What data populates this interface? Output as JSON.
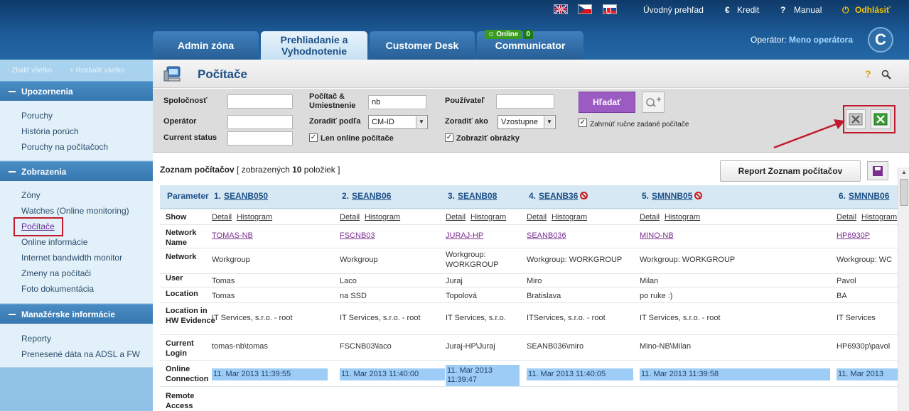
{
  "header": {
    "nav_links": [
      "Úvodný prehľad",
      "Kredit",
      "Manual",
      "Odhlásiť"
    ],
    "tabs": [
      "Admin zóna",
      "Prehliadanie a Vyhodnotenie",
      "Customer Desk",
      "Communicator"
    ],
    "online_label": "Online",
    "online_count": "0",
    "operator_label": "Operátor:",
    "operator_name": "Meno operátora",
    "logo_letter": "C"
  },
  "sidebar": {
    "collapse_all": "- Zbaliť všetko",
    "expand_all": "+ Rozbaliť všetko",
    "sections": [
      {
        "title": "Upozornenia",
        "items": [
          "Poruchy",
          "História porúch",
          "Poruchy na počítačoch"
        ]
      },
      {
        "title": "Zobrazenia",
        "items": [
          "Zóny",
          "Watches (Online monitoring)",
          "Počítače",
          "Online informácie",
          "Internet bandwidth monitor",
          "Zmeny na počítači",
          "Foto dokumentácia"
        ]
      },
      {
        "title": "Manažérske informácie",
        "items": [
          "Reporty",
          "Prenesené dáta na ADSL a FW"
        ]
      }
    ]
  },
  "page": {
    "title": "Počítače"
  },
  "filter": {
    "company_label": "Spoločnosť",
    "operator_label": "Operátor",
    "status_label": "Current status",
    "pc_label": "Počítač & Umiestnenie",
    "pc_value": "nb",
    "sort_by_label": "Zoradiť podľa",
    "sort_by_value": "CM-ID",
    "online_only_label": "Len online počítače",
    "user_label": "Používateľ",
    "sort_as_label": "Zoradiť ako",
    "sort_as_value": "Vzostupne",
    "show_images_label": "Zobraziť obrázky",
    "search_button": "Hľadať",
    "manual_pcs_label": "Zahrnúť ručne zadané počítače"
  },
  "list": {
    "title": "Zoznam počítačov",
    "count_prefix": "[ zobrazených ",
    "count": "10",
    "count_suffix": " položiek ]",
    "report_button": "Report Zoznam počítačov"
  },
  "table": {
    "param_header": "Parameter",
    "row_labels": [
      "Show",
      "Network Name",
      "Network",
      "User",
      "Location",
      "Location in HW Evidence",
      "Current Login",
      "Online Connection",
      "Remote Access"
    ],
    "detail_label": "Detail",
    "histogram_label": "Histogram",
    "columns": [
      {
        "num": "1.",
        "id": "SEANB050",
        "blocked": false,
        "network_name": "TOMAS-NB",
        "network": "Workgroup",
        "user": "Tomas",
        "location": "Tomas",
        "hw_location": "IT Services, s.r.o. - root",
        "login": "tomas-nb\\tomas",
        "online": "11. Mar 2013 11:39:55"
      },
      {
        "num": "2.",
        "id": "SEANB06",
        "blocked": false,
        "network_name": "FSCNB03",
        "network": "Workgroup",
        "user": "Laco",
        "location": "na SSD",
        "hw_location": "IT Services, s.r.o. - root",
        "login": "FSCNB03\\laco",
        "online": "11. Mar 2013 11:40:00"
      },
      {
        "num": "3.",
        "id": "SEANB08",
        "blocked": false,
        "network_name": "JURAJ-HP",
        "network": "Workgroup: WORKGROUP",
        "user": "Juraj",
        "location": "Topolová",
        "hw_location": "IT Services, s.r.o.",
        "login": "Juraj-HP\\Juraj",
        "online": "11. Mar 2013 11:39:47"
      },
      {
        "num": "4.",
        "id": "SEANB36",
        "blocked": true,
        "network_name": "SEANB036",
        "network": "Workgroup: WORKGROUP",
        "user": "Miro",
        "location": "Bratislava",
        "hw_location": "ITServices, s.r.o. - root",
        "login": "SEANB036\\miro",
        "online": "11. Mar 2013 11:40:05"
      },
      {
        "num": "5.",
        "id": "SMNNB05",
        "blocked": true,
        "network_name": "MINO-NB",
        "network": "Workgroup: WORKGROUP",
        "user": "Milan",
        "location": "po ruke :)",
        "hw_location": "IT Services, s.r.o. - root",
        "login": "Mino-NB\\Milan",
        "online": "11. Mar 2013 11:39:58"
      },
      {
        "num": "6.",
        "id": "SMNNB06",
        "blocked": false,
        "network_name": "HP6930P",
        "network": "Workgroup: WC",
        "user": "Pavol",
        "location": "BA",
        "hw_location": "IT Services",
        "login": "HP6930p\\pavol",
        "online": "11. Mar 2013"
      }
    ]
  }
}
